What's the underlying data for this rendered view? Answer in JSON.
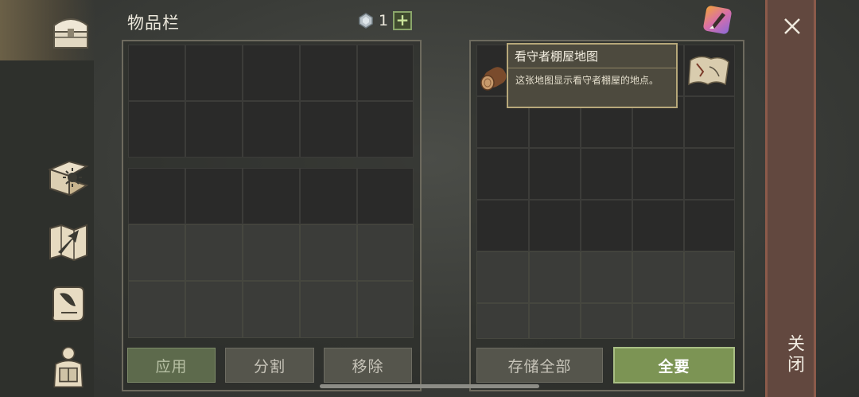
{
  "inventory": {
    "title": "物品栏",
    "currency_count": "1",
    "plus_label": "+",
    "buttons": {
      "apply": "应用",
      "split": "分割",
      "remove": "移除"
    }
  },
  "storage": {
    "buttons": {
      "store_all": "存储全部",
      "take_all": "全要"
    }
  },
  "tooltip": {
    "title": "看守者棚屋地图",
    "description": "这张地图显示看守者棚屋的地点。"
  },
  "close": {
    "label": "关闭"
  },
  "sidebar": {
    "items": [
      {
        "icon": "chest-icon"
      },
      {
        "icon": "sun-book-icon"
      },
      {
        "icon": "map-arrow-icon"
      },
      {
        "icon": "scroll-quill-icon"
      },
      {
        "icon": "character-backpack-icon"
      }
    ]
  },
  "colors": {
    "accent_green": "#7c9454",
    "close_strip": "#62483f",
    "tooltip_border": "#b7a87a"
  }
}
